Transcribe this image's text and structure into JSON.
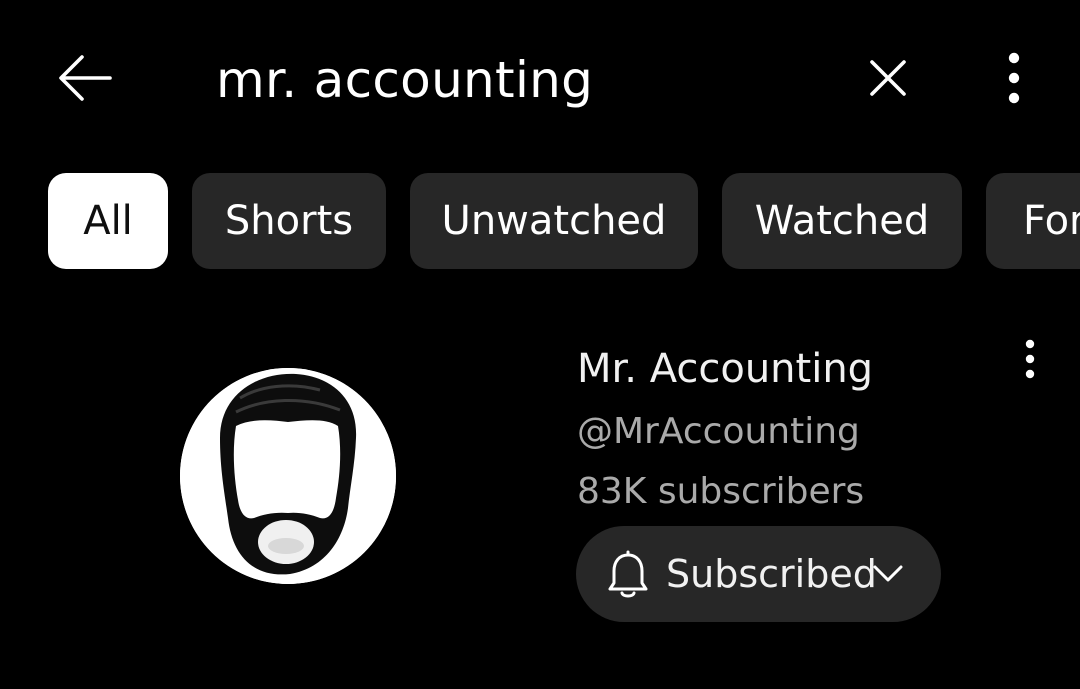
{
  "search": {
    "query": "mr. accounting"
  },
  "filters": [
    {
      "label": "All",
      "selected": true
    },
    {
      "label": "Shorts",
      "selected": false
    },
    {
      "label": "Unwatched",
      "selected": false
    },
    {
      "label": "Watched",
      "selected": false
    },
    {
      "label": "For",
      "selected": false
    }
  ],
  "result": {
    "channel_name": "Mr. Accounting",
    "handle": "@MrAccounting",
    "subscribers": "83K subscribers",
    "subscribe_button": {
      "label": "Subscribed",
      "icon": "bell-icon",
      "dropdown_icon": "chevron-down-icon"
    }
  },
  "icons": {
    "back": "arrow-left-icon",
    "clear": "close-icon",
    "more": "more-vert-icon"
  },
  "colors": {
    "background": "#000000",
    "chip_background": "#272727",
    "chip_selected_background": "#ffffff",
    "chip_selected_text": "#0f0f0f",
    "primary_text": "#f1f1f1",
    "secondary_text": "#aaaaaa"
  }
}
